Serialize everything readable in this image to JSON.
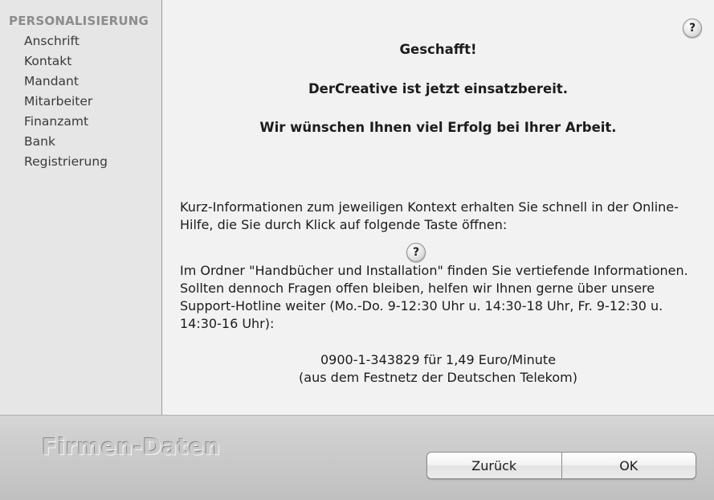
{
  "sidebar": {
    "heading": "PERSONALISIERUNG",
    "items": [
      {
        "label": "Anschrift"
      },
      {
        "label": "Kontakt"
      },
      {
        "label": "Mandant"
      },
      {
        "label": "Mitarbeiter"
      },
      {
        "label": "Finanzamt"
      },
      {
        "label": "Bank"
      },
      {
        "label": "Registrierung"
      }
    ]
  },
  "main": {
    "help_label": "?",
    "headline_1": "Geschafft!",
    "headline_2": "DerCreative ist jetzt einsatzbereit.",
    "headline_3": "Wir wünschen Ihnen viel Erfolg bei Ihrer Arbeit.",
    "info_paragraph": "Kurz-Informationen zum jeweiligen Kontext erhalten Sie schnell in der Online-Hilfe, die Sie durch Klick auf folgende Taste öffnen:",
    "support_paragraph": "Im Ordner \"Handbücher und Installation\" finden Sie vertiefende Informationen. Sollten dennoch Fragen offen bleiben, helfen wir Ihnen gerne über unsere Support-Hotline weiter (Mo.-Do. 9-12:30 Uhr u. 14:30-18 Uhr, Fr. 9-12:30 u. 14:30-16 Uhr):",
    "phone_line_1": "0900-1-343829 für 1,49 Euro/Minute",
    "phone_line_2": "(aus dem Festnetz der Deutschen Telekom)"
  },
  "footer": {
    "brand": "Firmen-Daten",
    "back_label": "Zurück",
    "ok_label": "OK"
  }
}
